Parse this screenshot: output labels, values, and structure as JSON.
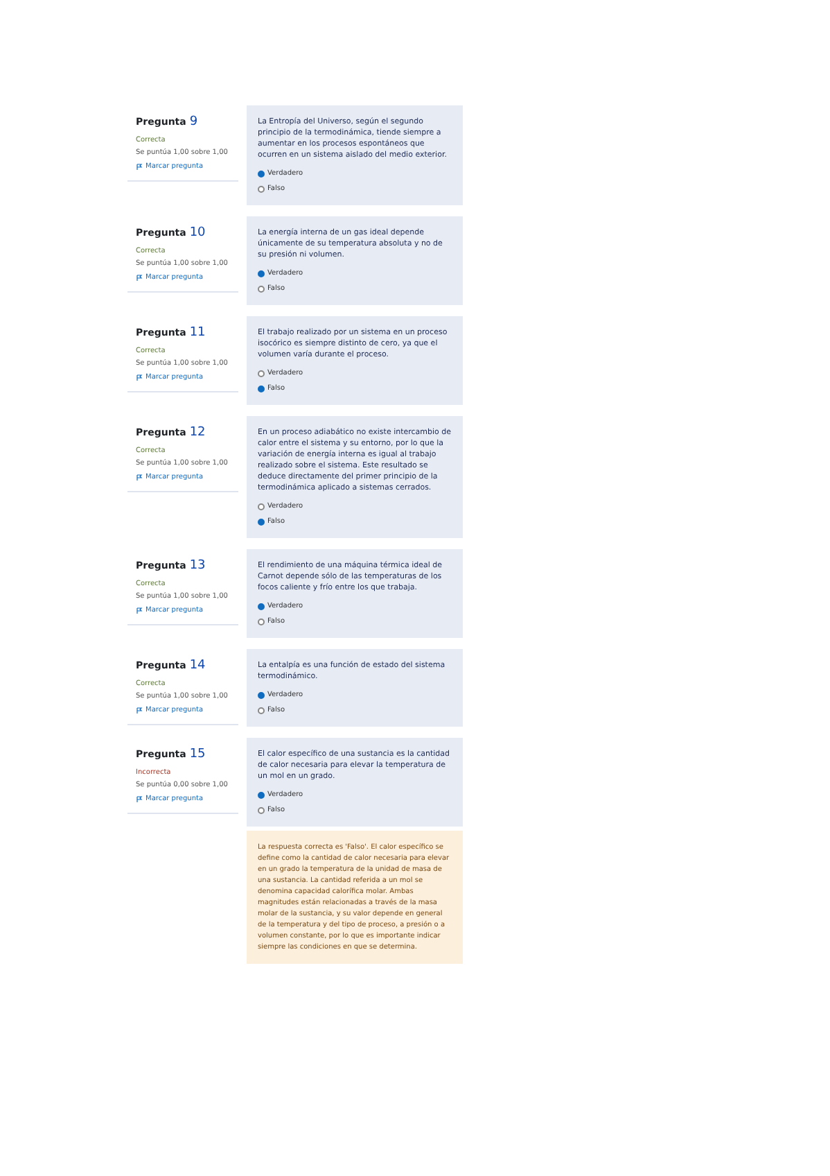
{
  "questions": [
    {
      "number": "9",
      "label": "Pregunta",
      "status": "Correcta",
      "score": "Se puntúa 1,00 sobre 1,00",
      "flag": "Marcar pregunta",
      "text": "La Entropía del Universo, según el segundo principio de la termodinámica, tiende siempre a aumentar en los procesos espontáneos que ocurren en un sistema aislado del medio exterior.",
      "options": [
        {
          "label": "Verdadero",
          "selected": true
        },
        {
          "label": "Falso",
          "selected": false
        }
      ]
    },
    {
      "number": "10",
      "label": "Pregunta",
      "status": "Correcta",
      "score": "Se puntúa 1,00 sobre 1,00",
      "flag": "Marcar pregunta",
      "text": "La energía interna de un gas ideal depende únicamente de su temperatura absoluta y no de su presión ni volumen.",
      "options": [
        {
          "label": "Verdadero",
          "selected": true
        },
        {
          "label": "Falso",
          "selected": false
        }
      ]
    },
    {
      "number": "11",
      "label": "Pregunta",
      "status": "Correcta",
      "score": "Se puntúa 1,00 sobre 1,00",
      "flag": "Marcar pregunta",
      "text": "El trabajo realizado por un sistema en un proceso isocórico es siempre distinto de cero, ya que el volumen varía durante el proceso.",
      "options": [
        {
          "label": "Verdadero",
          "selected": false
        },
        {
          "label": "Falso",
          "selected": true
        }
      ]
    },
    {
      "number": "12",
      "label": "Pregunta",
      "status": "Correcta",
      "score": "Se puntúa 1,00 sobre 1,00",
      "flag": "Marcar pregunta",
      "text": "En un proceso adiabático no existe intercambio de calor entre el sistema y su entorno, por lo que la variación de energía interna es igual al trabajo realizado sobre el sistema. Este resultado se deduce directamente del primer principio de la termodinámica aplicado a sistemas cerrados.",
      "options": [
        {
          "label": "Verdadero",
          "selected": false
        },
        {
          "label": "Falso",
          "selected": true
        }
      ]
    },
    {
      "number": "13",
      "label": "Pregunta",
      "status": "Correcta",
      "score": "Se puntúa 1,00 sobre 1,00",
      "flag": "Marcar pregunta",
      "text": "El rendimiento de una máquina térmica ideal de Carnot depende sólo de las temperaturas de los focos caliente y frío entre los que trabaja.",
      "options": [
        {
          "label": "Verdadero",
          "selected": true
        },
        {
          "label": "Falso",
          "selected": false
        }
      ]
    },
    {
      "number": "14",
      "label": "Pregunta",
      "status": "Correcta",
      "score": "Se puntúa 1,00 sobre 1,00",
      "flag": "Marcar pregunta",
      "text": "La entalpía es una función de estado del sistema termodinámico.",
      "options": [
        {
          "label": "Verdadero",
          "selected": true
        },
        {
          "label": "Falso",
          "selected": false
        }
      ]
    },
    {
      "number": "15",
      "label": "Pregunta",
      "status": "Incorrecta",
      "score": "Se puntúa 0,00 sobre 1,00",
      "flag": "Marcar pregunta",
      "text": "El calor específico de una sustancia es la cantidad de calor necesaria para elevar la temperatura de un mol en un grado.",
      "options": [
        {
          "label": "Verdadero",
          "selected": true
        },
        {
          "label": "Falso",
          "selected": false
        }
      ],
      "feedback": "La respuesta correcta es 'Falso'. El calor específico se define como la cantidad de calor necesaria para elevar en un grado la temperatura de la unidad de masa de una sustancia. La cantidad referida a un mol se denomina capacidad calorífica molar. Ambas magnitudes están relacionadas a través de la masa molar de la sustancia, y su valor depende en general de la temperatura y del tipo de proceso, a presión o a volumen constante, por lo que es importante indicar siempre las condiciones en que se determina."
    }
  ]
}
